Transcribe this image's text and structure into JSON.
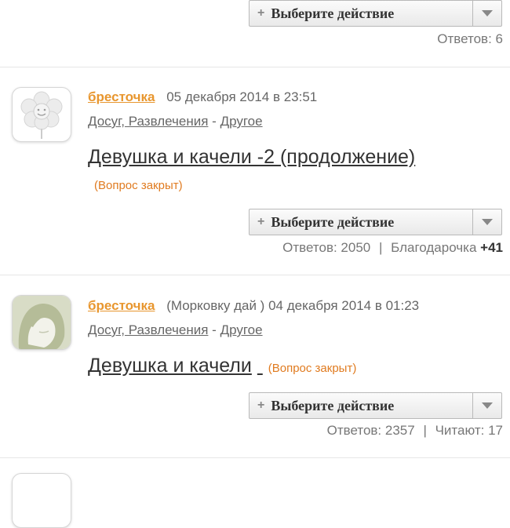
{
  "action_label": "Выберите действие",
  "posts": [
    {
      "stats": "Ответов: 6"
    },
    {
      "user": "бресточка",
      "nick": "",
      "date": "05 декабря 2014 в 23:51",
      "category": "Досуг, Развлечения",
      "sep": "-",
      "subcategory": "Другое",
      "title": "Девушка и качели -2 (продолжение)",
      "closed": "(Вопрос закрыт)",
      "stats_answers": "Ответов: 2050",
      "stats_sep": "|",
      "stats_extra_label": "Благодарочка",
      "stats_extra_value": "+41"
    },
    {
      "user": "бресточка",
      "nick": "(Морковку дай )",
      "date": "04 декабря 2014 в 01:23",
      "category": "Досуг, Развлечения",
      "sep": "-",
      "subcategory": "Другое",
      "title": "Девушка и качели",
      "closed": "(Вопрос закрыт)",
      "stats_answers": "Ответов: 2357",
      "stats_sep": "|",
      "stats_extra_label": "Читают: 17"
    }
  ],
  "icons": {
    "avatar1": "flower-avatar-icon",
    "avatar2": "woman-face-avatar-icon",
    "plus": "plus-icon",
    "caret": "chevron-down-icon"
  },
  "colors": {
    "username": "#e8962e",
    "closed": "#e07b20",
    "divider": "#e6e6e6"
  }
}
